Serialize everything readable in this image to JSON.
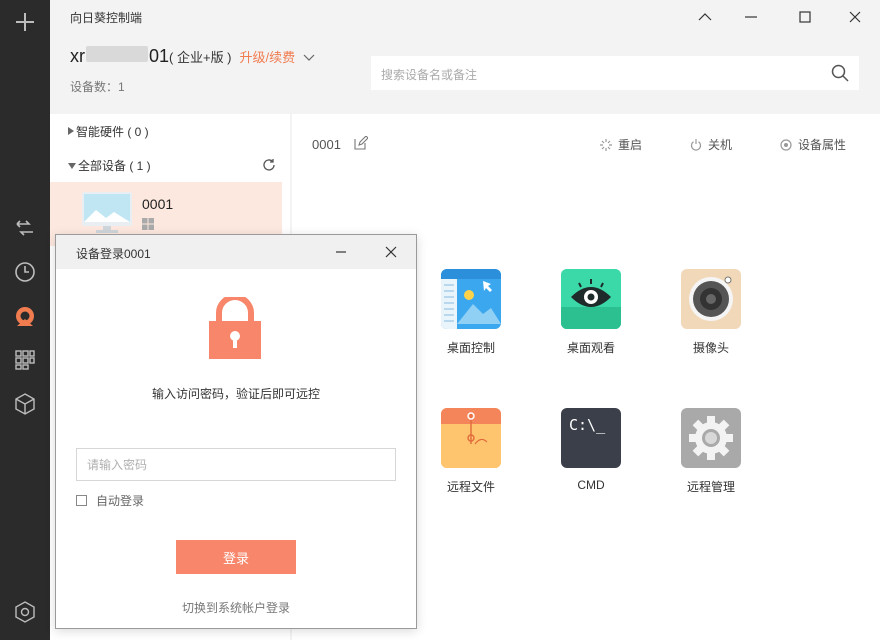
{
  "app": {
    "title": "向日葵控制端"
  },
  "account": {
    "user_prefix": "xr",
    "user_suffix": "01",
    "edition": "( 企业+版 )",
    "upgrade_label": "升级/续费",
    "device_count_label": "设备数：1"
  },
  "search": {
    "placeholder": "搜索设备名或备注"
  },
  "tree": {
    "smart_hardware": "智能硬件 ( 0 )",
    "all_devices": "全部设备 ( 1 )",
    "devices": [
      {
        "name": "0001",
        "os_icon": "windows-icon"
      }
    ]
  },
  "device_panel": {
    "name": "0001",
    "actions": [
      {
        "label": "重启",
        "icon": "restart-icon"
      },
      {
        "label": "关机",
        "icon": "power-icon"
      },
      {
        "label": "设备属性",
        "icon": "settings-icon"
      }
    ],
    "tiles": [
      {
        "label": "桌面控制",
        "icon": "desktop-control-icon"
      },
      {
        "label": "桌面观看",
        "icon": "eye-icon"
      },
      {
        "label": "摄像头",
        "icon": "camera-icon"
      },
      {
        "label": "远程文件",
        "icon": "folder-icon"
      },
      {
        "label": "CMD",
        "icon": "cmd-icon",
        "glyph": "C:\\_"
      },
      {
        "label": "远程管理",
        "icon": "gear-icon"
      }
    ]
  },
  "login_dialog": {
    "title": "设备登录0001",
    "hint": "输入访问密码，验证后即可远控",
    "password_placeholder": "请输入密码",
    "auto_login_label": "自动登录",
    "login_button": "登录",
    "switch_link": "切换到系统帐户登录"
  },
  "colors": {
    "accent": "#f07c50",
    "login_button": "#f7866a",
    "rail": "#2b2b2b",
    "selected_row": "#fde8df"
  }
}
